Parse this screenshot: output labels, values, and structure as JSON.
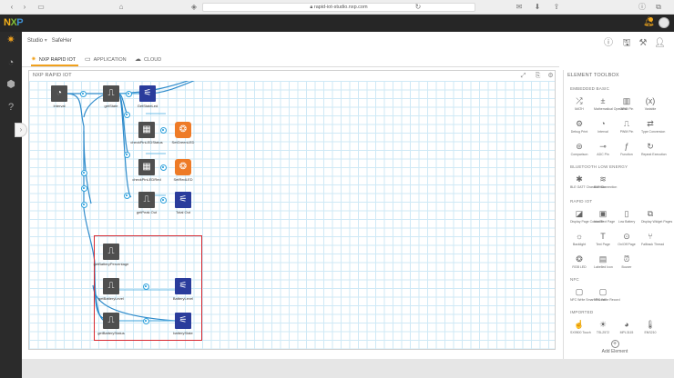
{
  "browser": {
    "url": "rapid-iot-studio.nxp.com",
    "icons": [
      "back-icon",
      "forward-icon",
      "sidebar-icon",
      "home-icon",
      "shield-icon",
      "reload-icon",
      "mail-icon",
      "download-icon",
      "share-icon",
      "tabs-icon"
    ]
  },
  "app": {
    "logo": {
      "n": "N",
      "x": "X",
      "p": "P"
    },
    "notification_color": "#f3a81c",
    "accent": "#f0a11d"
  },
  "header": {
    "studio": "Studio",
    "project": "SafeHer",
    "icons": [
      "info-icon",
      "save-icon",
      "build-icon",
      "user-icon"
    ]
  },
  "tabs": [
    {
      "label": "NXP RAPID IOT",
      "active": true
    },
    {
      "label": "APPLICATION",
      "active": false
    },
    {
      "label": "CLOUD",
      "active": false
    }
  ],
  "canvas": {
    "title": "NXP RAPID IOT",
    "nodes": [
      {
        "id": "interval",
        "label": "Interval",
        "color": "gray",
        "icon": "clock-icon"
      },
      {
        "id": "getstate",
        "label": "getState",
        "color": "gray",
        "icon": "pulse-icon"
      },
      {
        "id": "getstate_led",
        "label": "GetStateLed",
        "color": "blue",
        "icon": "led-icon"
      },
      {
        "id": "checkpin_status",
        "label": "checkPinLEDStatus",
        "color": "gray",
        "icon": "grid-icon"
      },
      {
        "id": "set_green_led",
        "label": "SetGreenLED",
        "color": "orange",
        "icon": "rgb-icon"
      },
      {
        "id": "checkpin_red",
        "label": "checkPinLEDRed",
        "color": "gray",
        "icon": "grid-icon"
      },
      {
        "id": "set_red_led",
        "label": "SetRedLED",
        "color": "orange",
        "icon": "rgb-icon"
      },
      {
        "id": "getpeak_out",
        "label": "getPeak Out",
        "color": "gray",
        "icon": "pulse-icon"
      },
      {
        "id": "total_out",
        "label": "Total Out",
        "color": "blue",
        "icon": "led-icon"
      },
      {
        "id": "get_battery_percent",
        "label": "getBatteryPercentage",
        "color": "gray",
        "icon": "pulse-icon"
      },
      {
        "id": "get_battery_level",
        "label": "getBatteryLevel",
        "color": "gray",
        "icon": "pulse-icon"
      },
      {
        "id": "battery_level",
        "label": "BatteryLevel",
        "color": "blue",
        "icon": "led-icon"
      },
      {
        "id": "get_battery_status",
        "label": "getBatteryStatus",
        "color": "gray",
        "icon": "pulse-icon"
      },
      {
        "id": "battery_state",
        "label": "batteryState",
        "color": "blue",
        "icon": "led-icon"
      }
    ]
  },
  "toolbox": {
    "title": "ELEMENT TOOLBOX",
    "sections": [
      {
        "name": "EMBEDDED BASIC",
        "items": [
          {
            "label": "MATH",
            "icon": "shuffle-icon"
          },
          {
            "label": "Mathematical Operation",
            "icon": "math-icon"
          },
          {
            "label": "GPIO Pin",
            "icon": "gpio-icon"
          },
          {
            "label": "Variable",
            "icon": "variable-icon"
          },
          {
            "label": "Debug Print",
            "icon": "debug-icon"
          },
          {
            "label": "Interval",
            "icon": "clock-icon"
          },
          {
            "label": "PWM Pin",
            "icon": "pwm-icon"
          },
          {
            "label": "Type Conversion",
            "icon": "convert-icon"
          },
          {
            "label": "Comparison",
            "icon": "compare-icon"
          },
          {
            "label": "ADC Pin",
            "icon": "adc-icon"
          },
          {
            "label": "Function",
            "icon": "function-icon"
          },
          {
            "label": "Repeat Execution",
            "icon": "repeat-icon"
          }
        ]
      },
      {
        "name": "BLUETOOTH LOW ENERGY",
        "items": [
          {
            "label": "BLE GATT Characteristic",
            "icon": "ble-icon"
          },
          {
            "label": "BLE Connection",
            "icon": "wifi-icon"
          }
        ]
      },
      {
        "name": "RAPID IOT",
        "items": [
          {
            "label": "Display Page Controller",
            "icon": "display-icon"
          },
          {
            "label": "Icon Text Page",
            "icon": "icon-text-icon"
          },
          {
            "label": "Low Battery",
            "icon": "battery-icon"
          },
          {
            "label": "Display Widget Pages",
            "icon": "widgets-icon"
          },
          {
            "label": "Backlight",
            "icon": "bulb-icon"
          },
          {
            "label": "Text Page",
            "icon": "text-icon"
          },
          {
            "label": "On/Off Page",
            "icon": "toggle-icon"
          },
          {
            "label": "Fallback Thread",
            "icon": "thread-icon"
          },
          {
            "label": "RGB LED",
            "icon": "rgb-icon"
          },
          {
            "label": "Labelled Icon",
            "icon": "label-icon"
          },
          {
            "label": "Buzzer",
            "icon": "buzzer-icon"
          }
        ]
      },
      {
        "name": "NFC",
        "items": [
          {
            "label": "NFC Write Smart Record",
            "icon": "nfc-icon"
          },
          {
            "label": "NFC Write Record",
            "icon": "nfc-record-icon"
          }
        ]
      },
      {
        "name": "IMPORTED",
        "items": [
          {
            "label": "SX9500 Touch",
            "icon": "touch-icon"
          },
          {
            "label": "TSL2572",
            "icon": "sun-icon"
          },
          {
            "label": "MPL3115",
            "icon": "gauge-icon"
          },
          {
            "label": "ENS210",
            "icon": "thermo-icon"
          }
        ]
      }
    ],
    "add_element": "Add Element"
  }
}
